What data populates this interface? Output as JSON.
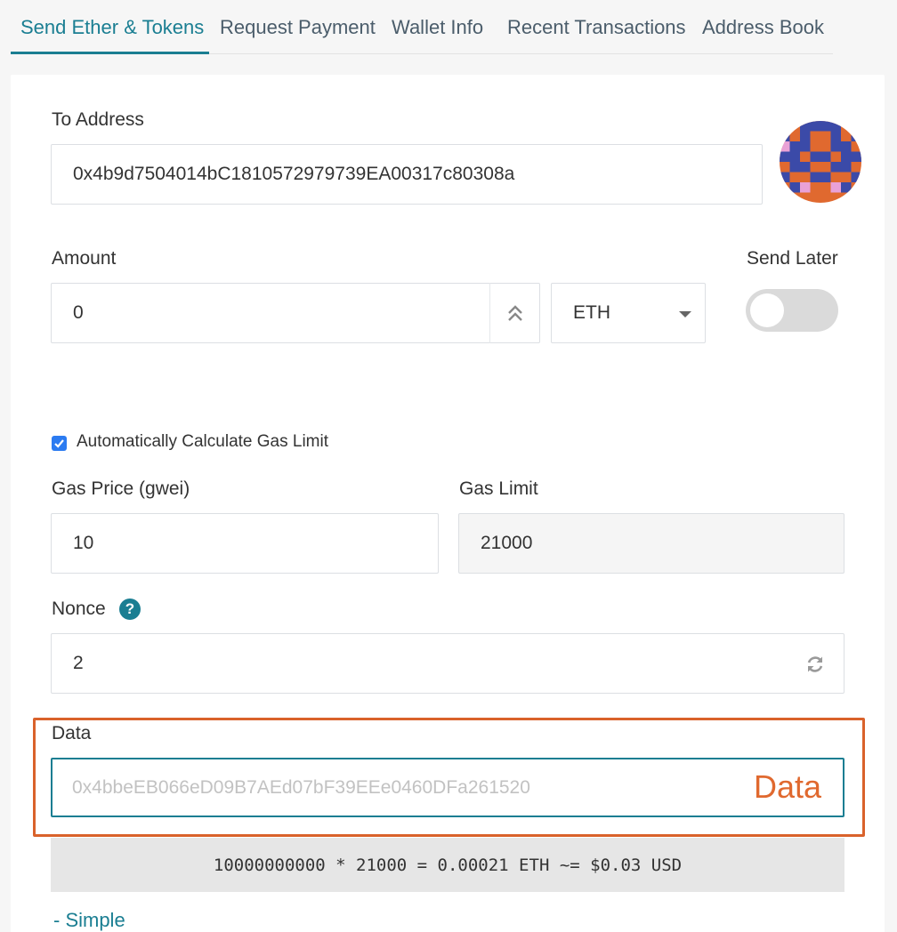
{
  "tabs": [
    {
      "label": "Send Ether & Tokens",
      "active": true
    },
    {
      "label": "Request Payment",
      "active": false
    },
    {
      "label": "Wallet Info",
      "active": false
    },
    {
      "label": "Recent Transactions",
      "active": false
    },
    {
      "label": "Address Book",
      "active": false
    }
  ],
  "to_address": {
    "label": "To Address",
    "value": "0x4b9d7504014bC1810572979739EA00317c80308a",
    "identicon": "identicon-avatar"
  },
  "amount": {
    "label": "Amount",
    "value": "0",
    "max_icon": "double-chevron-up-icon",
    "unit": "ETH"
  },
  "send_later": {
    "label": "Send Later",
    "enabled": false
  },
  "gas": {
    "auto_label": "Automatically Calculate Gas Limit",
    "auto_checked": true,
    "price_label": "Gas Price (gwei)",
    "price_value": "10",
    "limit_label": "Gas Limit",
    "limit_value": "21000"
  },
  "nonce": {
    "label": "Nonce",
    "help_icon": "?",
    "value": "2",
    "refresh_icon": "refresh-icon"
  },
  "data": {
    "label": "Data",
    "placeholder": "0x4bbeEB066eD09B7AEd07bF39EEe0460DFa261520",
    "badge": "Data"
  },
  "summary": "10000000000 * 21000 = 0.00021 ETH ~= $0.03 USD",
  "simple_link": "- Simple",
  "colors": {
    "accent": "#1a7e92",
    "highlight": "#d9622b",
    "checkbox": "#2b7bf1"
  }
}
